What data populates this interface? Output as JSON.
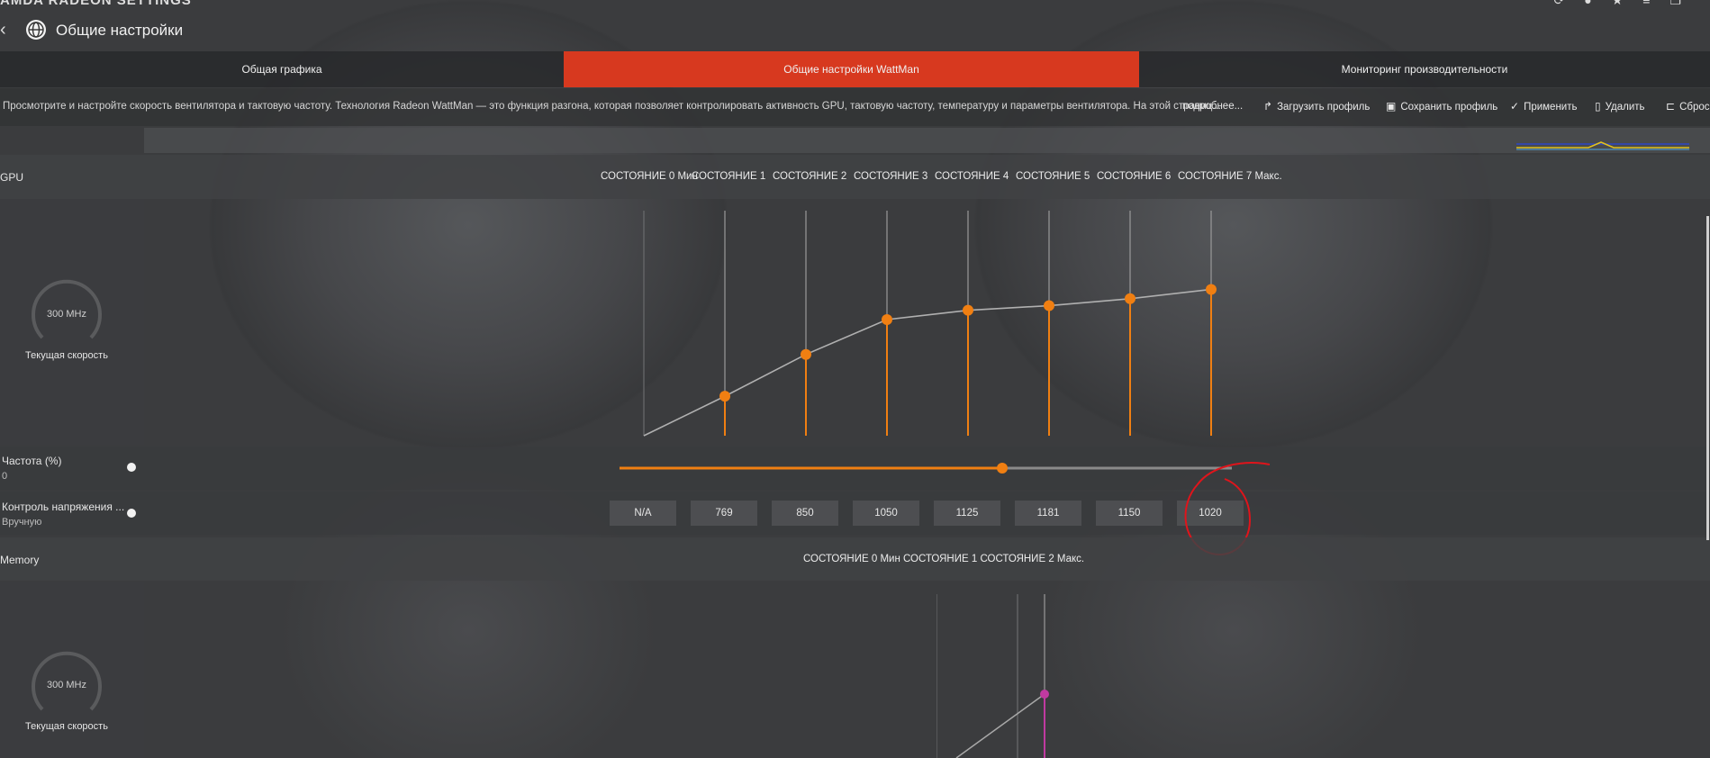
{
  "header": {
    "brand": "AMDA RADEON SETTINGS",
    "title": "Общие настройки",
    "back_icon": "chevron-left-icon",
    "globe_icon": "globe-icon"
  },
  "tabs": [
    {
      "label": "Общая графика",
      "active": false
    },
    {
      "label": "Общие настройки WattMan",
      "active": true
    },
    {
      "label": "Мониторинг производительности",
      "active": false
    }
  ],
  "infobar": {
    "description": "Просмотрите и настройте скорость вентилятора и тактовую частоту. Технология Radeon WattMan — это функция разгона, которая позволяет контролировать активность GPU, тактовую частоту, температуру и параметры вентилятора. На этой страниц...",
    "more": "подробнее...",
    "actions": [
      {
        "label": "Загрузить профиль",
        "icon": "share-icon"
      },
      {
        "label": "Сохранить профиль",
        "icon": "save-icon"
      },
      {
        "label": "Применить",
        "icon": "check-icon"
      },
      {
        "label": "Удалить",
        "icon": "trash-icon"
      },
      {
        "label": "Сброс",
        "icon": "reset-icon"
      }
    ]
  },
  "gpu": {
    "label": "GPU",
    "states": [
      "СОСТОЯНИЕ 0 Мин",
      "СОСТОЯНИЕ 1",
      "СОСТОЯНИЕ 2",
      "СОСТОЯНИЕ 3",
      "СОСТОЯНИЕ 4",
      "СОСТОЯНИЕ 5",
      "СОСТОЯНИЕ 6",
      "СОСТОЯНИЕ 7 Макс."
    ],
    "gauge_value": "300 MHz",
    "gauge_caption": "Текущая скорость",
    "curve_levels": [
      0.0,
      0.17,
      0.35,
      0.5,
      0.54,
      0.56,
      0.59,
      0.63
    ],
    "frequency_label": "Частота (%)",
    "frequency_value": "0",
    "frequency_slider_fraction": 0.625,
    "voltage_label": "Контроль напряжения ...",
    "voltage_mode": "Вручную",
    "voltages": [
      "N/A",
      "769",
      "850",
      "1050",
      "1125",
      "1181",
      "1150",
      "1020"
    ]
  },
  "memory": {
    "label": "Memory",
    "states_line": "СОСТОЯНИЕ 0 Мин  СОСТОЯНИЕ 1 СОСТОЯНИЕ 2 Макс.",
    "gauge_value": "300 MHz",
    "gauge_caption": "Текущая скорость"
  },
  "colors": {
    "accent": "#d7391f",
    "gpu_curve": "#f07f12",
    "memory_curve": "#c03aa0",
    "annotation": "#e0141b"
  }
}
